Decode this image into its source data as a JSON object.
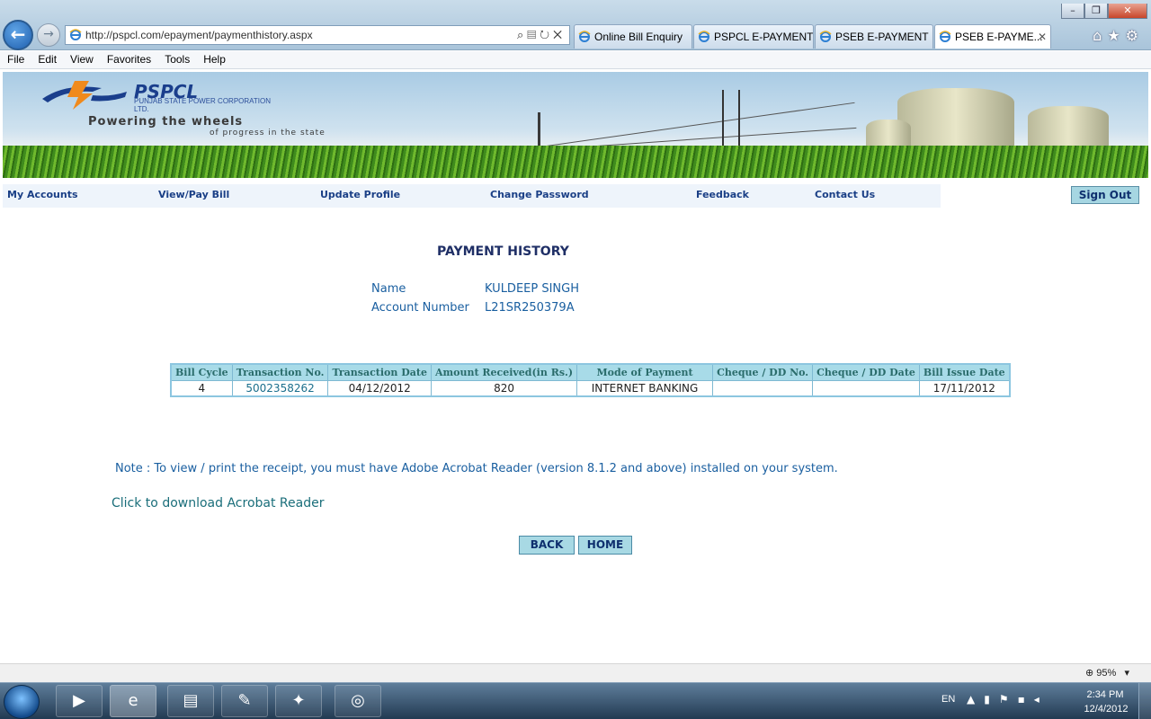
{
  "browser": {
    "url": "http://pspcl.com/epayment/paymenthistory.aspx",
    "tabs": [
      {
        "label": "Online Bill Enquiry",
        "active": false
      },
      {
        "label": "PSPCL E-PAYMENT",
        "active": false
      },
      {
        "label": "PSEB E-PAYMENT",
        "active": false
      },
      {
        "label": "PSEB E-PAYME...",
        "active": true
      }
    ],
    "menu": [
      "File",
      "Edit",
      "View",
      "Favorites",
      "Tools",
      "Help"
    ],
    "zoom": "95%"
  },
  "banner": {
    "brand": "PSPCL",
    "corp_name": "PUNJAB STATE POWER CORPORATION LTD.",
    "tagline_1": "Powering the wheels",
    "tagline_2": "of progress in the state"
  },
  "site_nav": {
    "my_accounts": "My Accounts",
    "view_pay_bill": "View/Pay Bill",
    "update_profile": "Update Profile",
    "change_password": "Change Password",
    "feedback": "Feedback",
    "contact_us": "Contact Us",
    "sign_out": "Sign Out"
  },
  "page": {
    "title": "PAYMENT HISTORY",
    "name_label": "Name",
    "name_value": "KULDEEP SINGH",
    "account_label": "Account Number",
    "account_value": "L21SR250379A"
  },
  "table": {
    "headers": [
      "Bill Cycle",
      "Transaction No.",
      "Transaction Date",
      "Amount Received(in Rs.)",
      "Mode of Payment",
      "Cheque / DD No.",
      "Cheque / DD Date",
      "Bill Issue Date"
    ],
    "rows": [
      [
        "4",
        "5002358262",
        "04/12/2012",
        "820",
        "INTERNET BANKING",
        "",
        "",
        "17/11/2012"
      ]
    ]
  },
  "note": "Note : To view / print the receipt, you must have Adobe Acrobat Reader (version 8.1.2 and above) installed on your system.",
  "acrobat_link": "Click to download Acrobat Reader",
  "buttons": {
    "back": "BACK",
    "home": "HOME"
  },
  "taskbar": {
    "language": "EN",
    "time": "2:34 PM",
    "date": "12/4/2012"
  }
}
